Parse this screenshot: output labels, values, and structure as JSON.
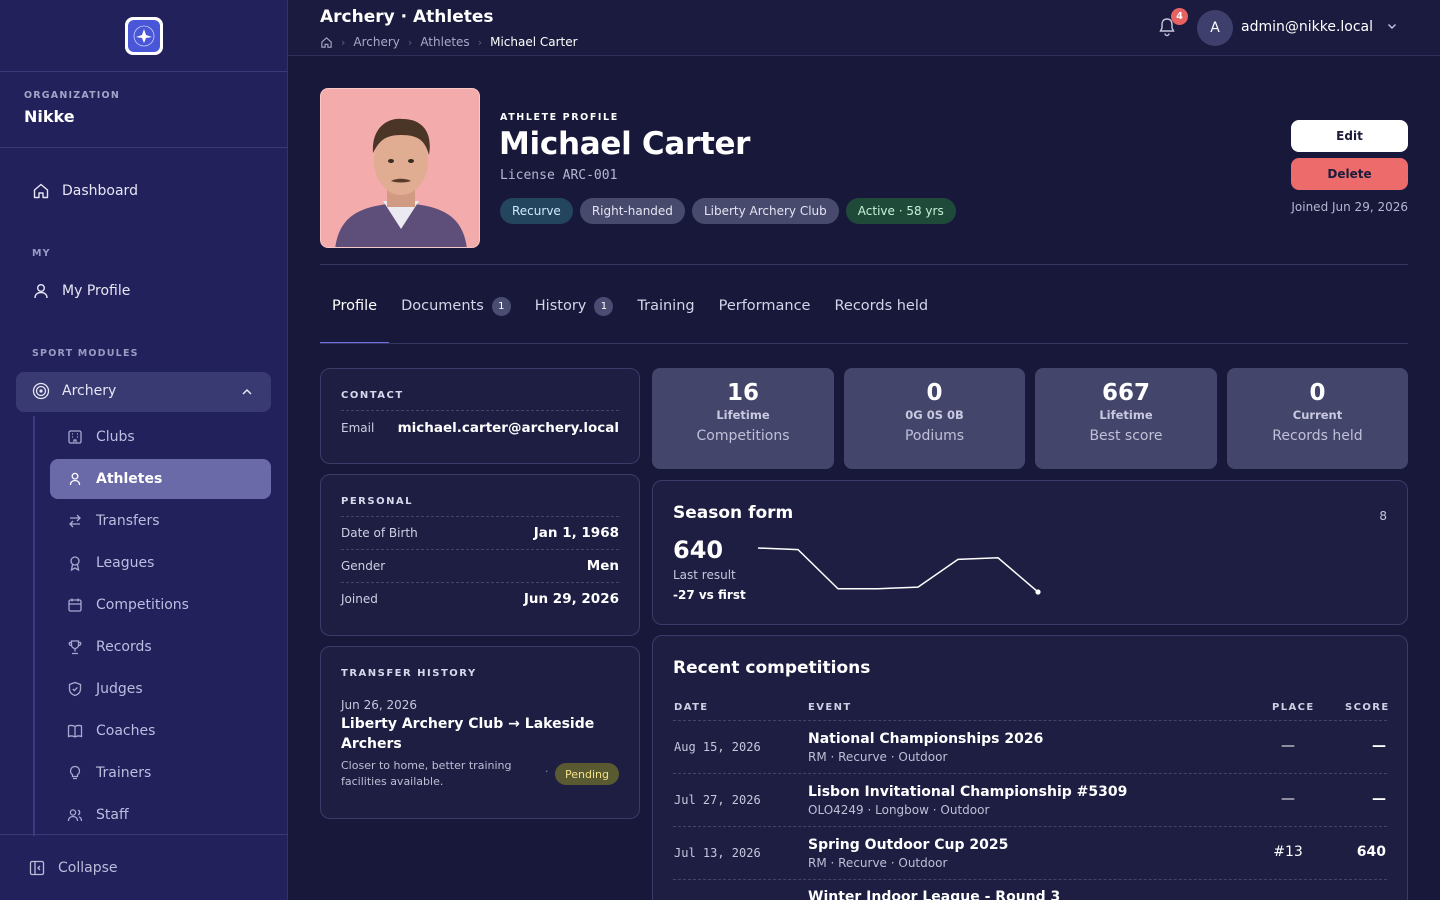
{
  "sidebar": {
    "org_label": "ORGANIZATION",
    "org_name": "Nikke",
    "dashboard": "Dashboard",
    "my_section": "MY",
    "my_profile": "My Profile",
    "sport_section": "SPORT MODULES",
    "archery": "Archery",
    "sub_items": [
      "Clubs",
      "Athletes",
      "Transfers",
      "Leagues",
      "Competitions",
      "Records",
      "Judges",
      "Coaches",
      "Trainers",
      "Staff"
    ],
    "collapse": "Collapse"
  },
  "header": {
    "title": "Archery · Athletes",
    "breadcrumbs": [
      "Archery",
      "Athletes",
      "Michael Carter"
    ],
    "notification_count": "4",
    "avatar_initial": "A",
    "user": "admin@nikke.local"
  },
  "profile": {
    "kicker": "ATHLETE PROFILE",
    "name": "Michael Carter",
    "license": "License ARC-001",
    "chips": [
      "Recurve",
      "Right-handed",
      "Liberty Archery Club",
      "Active · 58 yrs"
    ],
    "edit_label": "Edit",
    "delete_label": "Delete",
    "joined": "Joined Jun 29, 2026"
  },
  "tabs": [
    {
      "label": "Profile",
      "count": ""
    },
    {
      "label": "Documents",
      "count": "1"
    },
    {
      "label": "History",
      "count": "1"
    },
    {
      "label": "Training",
      "count": ""
    },
    {
      "label": "Performance",
      "count": ""
    },
    {
      "label": "Records held",
      "count": ""
    }
  ],
  "contact": {
    "heading": "CONTACT",
    "email_label": "Email",
    "email": "michael.carter@archery.local"
  },
  "personal": {
    "heading": "PERSONAL",
    "rows": [
      {
        "k": "Date of Birth",
        "v": "Jan 1, 1968"
      },
      {
        "k": "Gender",
        "v": "Men"
      },
      {
        "k": "Joined",
        "v": "Jun 29, 2026"
      }
    ]
  },
  "transfer": {
    "heading": "TRANSFER HISTORY",
    "date": "Jun 26, 2026",
    "route": "Liberty Archery Club → Lakeside Archers",
    "note": "Closer to home, better training facilities available.",
    "dot": "·",
    "status": "Pending"
  },
  "stats": [
    {
      "n": "16",
      "s": "Lifetime",
      "l": "Competitions"
    },
    {
      "n": "0",
      "s": "0G 0S 0B",
      "l": "Podiums"
    },
    {
      "n": "667",
      "s": "Lifetime",
      "l": "Best score"
    },
    {
      "n": "0",
      "s": "Current",
      "l": "Records held"
    }
  ],
  "season": {
    "title": "Season form",
    "count": "8",
    "value": "640",
    "value_label": "Last result",
    "delta": "-27 vs first"
  },
  "chart_data": {
    "type": "line",
    "series": [
      {
        "values": [
          667,
          666,
          642,
          642,
          643,
          660,
          661,
          640
        ]
      }
    ]
  },
  "recent": {
    "title": "Recent competitions",
    "columns": [
      "DATE",
      "EVENT",
      "PLACE",
      "SCORE"
    ],
    "rows": [
      {
        "date": "Aug 15, 2026",
        "event": "National Championships 2026",
        "sub": "RM · Recurve · Outdoor",
        "place": "—",
        "score": "—"
      },
      {
        "date": "Jul 27, 2026",
        "event": "Lisbon Invitational Championship #5309",
        "sub": "OLO4249 · Longbow · Outdoor",
        "place": "—",
        "score": "—"
      },
      {
        "date": "Jul 13, 2026",
        "event": "Spring Outdoor Cup 2025",
        "sub": "RM · Recurve · Outdoor",
        "place": "#13",
        "score": "640"
      },
      {
        "date": "",
        "event": "Winter Indoor League - Round 3",
        "sub": "",
        "place": "",
        "score": ""
      }
    ]
  },
  "colors": {
    "accent": "#6e6ee0",
    "danger": "#ee6b6b",
    "sidebar": "#22215c",
    "bg": "#18193a"
  }
}
